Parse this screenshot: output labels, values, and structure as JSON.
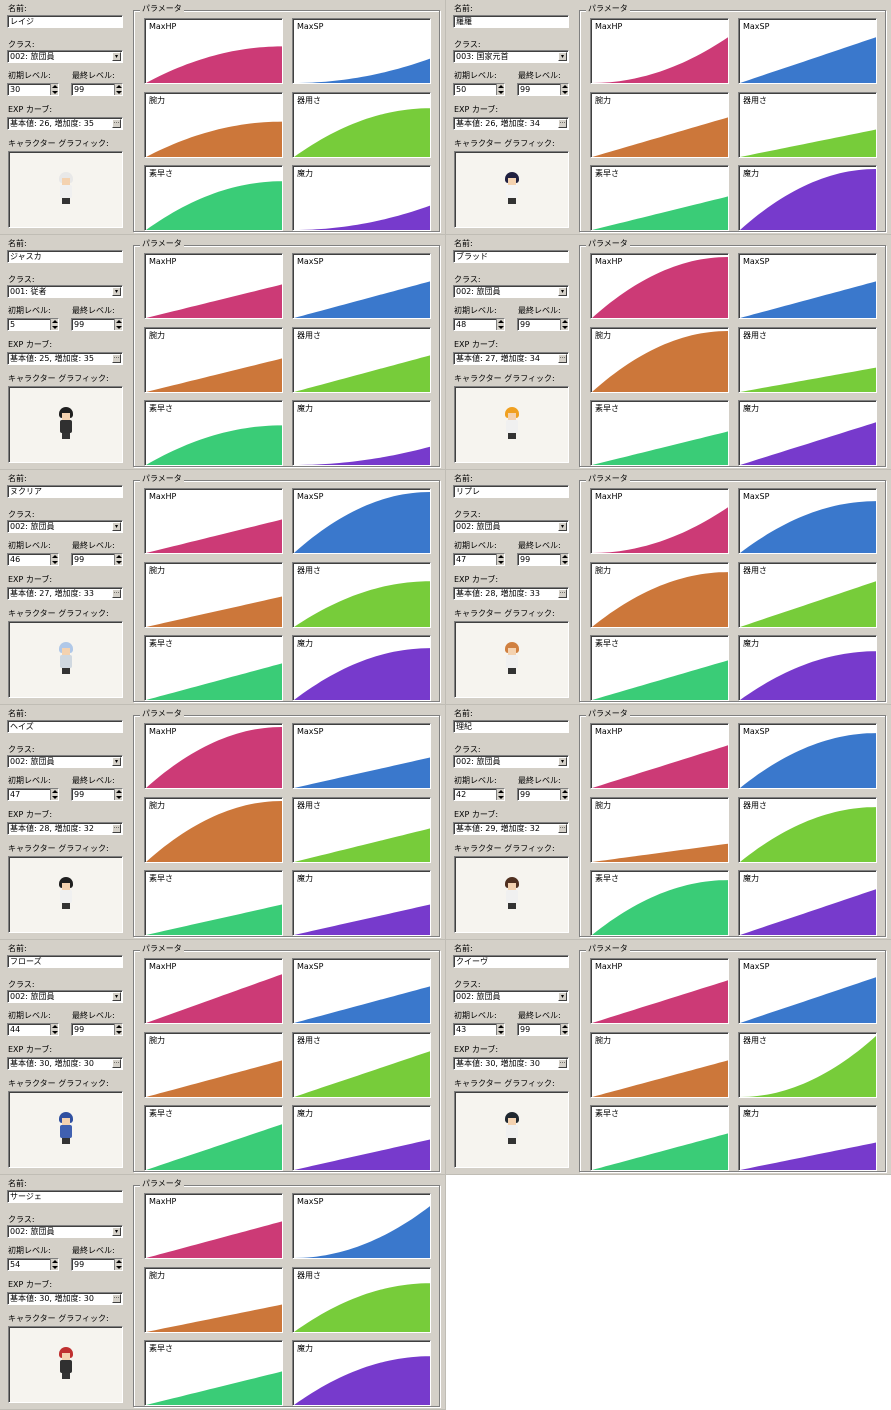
{
  "labels": {
    "name": "名前:",
    "class": "クラス:",
    "initial_level": "初期レベル:",
    "final_level": "最終レベル:",
    "exp_curve": "EXP カーブ:",
    "graphic": "キャラクター グラフィック:",
    "parameters": "パラメータ"
  },
  "param_names": [
    "MaxHP",
    "MaxSP",
    "腕力",
    "器用さ",
    "素早さ",
    "魔力"
  ],
  "param_colors": [
    "#cc3a76",
    "#3a78cc",
    "#cc773a",
    "#77cc3a",
    "#3acc77",
    "#773acc"
  ],
  "icons": {
    "dropdown": "chevron-down-icon",
    "ellipsis": "ellipsis-icon",
    "spin": "spin-arrows-icon"
  },
  "characters": [
    {
      "name": "レイジ",
      "class": "002: 旅団員",
      "initial_level": "30",
      "final_level": "99",
      "exp_curve": "基本値: 26, 増加度: 35",
      "sprite": {
        "hair": "#e8e8e8",
        "body": "#f0f0f0"
      },
      "curves": [
        {
          "start": 0.0,
          "end": 0.6,
          "shape": "concave"
        },
        {
          "start": 0.0,
          "end": 0.4,
          "shape": "convex"
        },
        {
          "start": 0.0,
          "end": 0.58,
          "shape": "concave"
        },
        {
          "start": 0.0,
          "end": 0.8,
          "shape": "concave"
        },
        {
          "start": 0.0,
          "end": 0.8,
          "shape": "concave"
        },
        {
          "start": 0.0,
          "end": 0.4,
          "shape": "convex"
        }
      ]
    },
    {
      "name": "羅羅",
      "class": "003: 国家元首",
      "initial_level": "50",
      "final_level": "99",
      "exp_curve": "基本値: 26, 増加度: 34",
      "sprite": {
        "hair": "#202040",
        "body": "#f4f4f4"
      },
      "curves": [
        {
          "start": 0.0,
          "end": 0.75,
          "shape": "convex"
        },
        {
          "start": 0.0,
          "end": 0.75,
          "shape": "linear"
        },
        {
          "start": 0.0,
          "end": 0.65,
          "shape": "linear"
        },
        {
          "start": 0.0,
          "end": 0.45,
          "shape": "linear"
        },
        {
          "start": 0.0,
          "end": 0.55,
          "shape": "linear"
        },
        {
          "start": 0.0,
          "end": 1.0,
          "shape": "concave"
        }
      ]
    },
    {
      "name": "ジャスカ",
      "class": "001: 従者",
      "initial_level": "5",
      "final_level": "99",
      "exp_curve": "基本値: 25, 増加度: 35",
      "sprite": {
        "hair": "#202020",
        "body": "#303030"
      },
      "curves": [
        {
          "start": 0.0,
          "end": 0.55,
          "shape": "linear"
        },
        {
          "start": 0.0,
          "end": 0.6,
          "shape": "linear"
        },
        {
          "start": 0.0,
          "end": 0.55,
          "shape": "linear"
        },
        {
          "start": 0.0,
          "end": 0.6,
          "shape": "linear"
        },
        {
          "start": 0.0,
          "end": 0.65,
          "shape": "concave"
        },
        {
          "start": 0.0,
          "end": 0.3,
          "shape": "convex"
        }
      ]
    },
    {
      "name": "ブラッド",
      "class": "002: 旅団員",
      "initial_level": "48",
      "final_level": "99",
      "exp_curve": "基本値: 27, 増加度: 34",
      "sprite": {
        "hair": "#f0a020",
        "body": "#f0f0f0"
      },
      "curves": [
        {
          "start": 0.0,
          "end": 1.0,
          "shape": "concave"
        },
        {
          "start": 0.0,
          "end": 0.6,
          "shape": "linear"
        },
        {
          "start": 0.0,
          "end": 1.0,
          "shape": "concave"
        },
        {
          "start": 0.0,
          "end": 0.4,
          "shape": "linear"
        },
        {
          "start": 0.0,
          "end": 0.55,
          "shape": "linear"
        },
        {
          "start": 0.0,
          "end": 0.7,
          "shape": "linear"
        }
      ]
    },
    {
      "name": "ヌクリア",
      "class": "002: 旅団員",
      "initial_level": "46",
      "final_level": "99",
      "exp_curve": "基本値: 27, 増加度: 33",
      "sprite": {
        "hair": "#b0c8e8",
        "body": "#d0d8e0"
      },
      "curves": [
        {
          "start": 0.0,
          "end": 0.55,
          "shape": "linear"
        },
        {
          "start": 0.0,
          "end": 1.0,
          "shape": "concave"
        },
        {
          "start": 0.0,
          "end": 0.5,
          "shape": "linear"
        },
        {
          "start": 0.0,
          "end": 0.75,
          "shape": "concave"
        },
        {
          "start": 0.0,
          "end": 0.6,
          "shape": "linear"
        },
        {
          "start": 0.0,
          "end": 0.85,
          "shape": "concave"
        }
      ]
    },
    {
      "name": "リプレ",
      "class": "002: 旅団員",
      "initial_level": "47",
      "final_level": "99",
      "exp_curve": "基本値: 28, 増加度: 33",
      "sprite": {
        "hair": "#d08040",
        "body": "#f0f0f0"
      },
      "curves": [
        {
          "start": 0.0,
          "end": 0.75,
          "shape": "convex"
        },
        {
          "start": 0.0,
          "end": 0.85,
          "shape": "concave"
        },
        {
          "start": 0.0,
          "end": 0.9,
          "shape": "concave"
        },
        {
          "start": 0.0,
          "end": 0.75,
          "shape": "linear"
        },
        {
          "start": 0.0,
          "end": 0.65,
          "shape": "linear"
        },
        {
          "start": 0.0,
          "end": 0.8,
          "shape": "concave"
        }
      ]
    },
    {
      "name": "ヘイズ",
      "class": "002: 旅団員",
      "initial_level": "47",
      "final_level": "99",
      "exp_curve": "基本値: 28, 増加度: 32",
      "sprite": {
        "hair": "#202020",
        "body": "#f0f0f0"
      },
      "curves": [
        {
          "start": 0.0,
          "end": 1.0,
          "shape": "concave"
        },
        {
          "start": 0.0,
          "end": 0.5,
          "shape": "linear"
        },
        {
          "start": 0.0,
          "end": 1.0,
          "shape": "concave"
        },
        {
          "start": 0.0,
          "end": 0.55,
          "shape": "linear"
        },
        {
          "start": 0.0,
          "end": 0.5,
          "shape": "linear"
        },
        {
          "start": 0.0,
          "end": 0.5,
          "shape": "linear"
        }
      ]
    },
    {
      "name": "理紀",
      "class": "002: 旅団員",
      "initial_level": "42",
      "final_level": "99",
      "exp_curve": "基本値: 29, 増加度: 32",
      "sprite": {
        "hair": "#503020",
        "body": "#f0f0f0"
      },
      "curves": [
        {
          "start": 0.0,
          "end": 0.7,
          "shape": "linear"
        },
        {
          "start": 0.0,
          "end": 0.9,
          "shape": "concave"
        },
        {
          "start": 0.0,
          "end": 0.3,
          "shape": "linear"
        },
        {
          "start": 0.0,
          "end": 0.9,
          "shape": "concave"
        },
        {
          "start": 0.0,
          "end": 0.9,
          "shape": "concave"
        },
        {
          "start": 0.0,
          "end": 0.75,
          "shape": "linear"
        }
      ]
    },
    {
      "name": "フローズ",
      "class": "002: 旅団員",
      "initial_level": "44",
      "final_level": "99",
      "exp_curve": "基本値: 30, 増加度: 30",
      "sprite": {
        "hair": "#3050a0",
        "body": "#4060b0"
      },
      "curves": [
        {
          "start": 0.0,
          "end": 0.8,
          "shape": "linear"
        },
        {
          "start": 0.0,
          "end": 0.6,
          "shape": "linear"
        },
        {
          "start": 0.0,
          "end": 0.6,
          "shape": "linear"
        },
        {
          "start": 0.0,
          "end": 0.75,
          "shape": "linear"
        },
        {
          "start": 0.0,
          "end": 0.75,
          "shape": "linear"
        },
        {
          "start": 0.0,
          "end": 0.5,
          "shape": "linear"
        }
      ]
    },
    {
      "name": "クイーヴ",
      "class": "002: 旅団員",
      "initial_level": "43",
      "final_level": "99",
      "exp_curve": "基本値: 30, 増加度: 30",
      "sprite": {
        "hair": "#202830",
        "body": "#f0f0f0"
      },
      "curves": [
        {
          "start": 0.0,
          "end": 0.7,
          "shape": "linear"
        },
        {
          "start": 0.0,
          "end": 0.75,
          "shape": "linear"
        },
        {
          "start": 0.0,
          "end": 0.6,
          "shape": "linear"
        },
        {
          "start": 0.0,
          "end": 1.0,
          "shape": "convex"
        },
        {
          "start": 0.0,
          "end": 0.6,
          "shape": "linear"
        },
        {
          "start": 0.0,
          "end": 0.45,
          "shape": "linear"
        }
      ]
    },
    {
      "name": "サージェ",
      "class": "002: 旅団員",
      "initial_level": "54",
      "final_level": "99",
      "exp_curve": "基本値: 30, 増加度: 30",
      "sprite": {
        "hair": "#c03030",
        "body": "#303030"
      },
      "curves": [
        {
          "start": 0.0,
          "end": 0.6,
          "shape": "linear"
        },
        {
          "start": 0.0,
          "end": 0.85,
          "shape": "convex"
        },
        {
          "start": 0.0,
          "end": 0.45,
          "shape": "linear"
        },
        {
          "start": 0.0,
          "end": 0.8,
          "shape": "concave"
        },
        {
          "start": 0.0,
          "end": 0.55,
          "shape": "linear"
        },
        {
          "start": 0.0,
          "end": 0.8,
          "shape": "concave"
        }
      ]
    }
  ]
}
